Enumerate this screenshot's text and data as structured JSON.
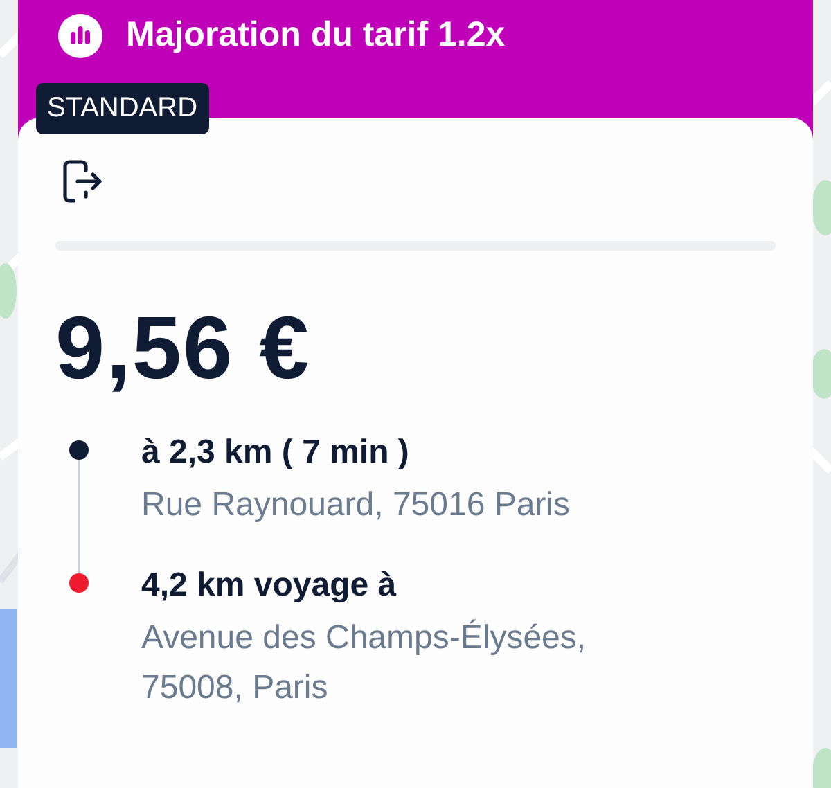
{
  "banner": {
    "title": "Majoration du tarif 1.2x"
  },
  "badge": "STANDARD",
  "price": "9,56 €",
  "stops": [
    {
      "title": "à 2,3 km ( 7 min )",
      "address": "Rue Raynouard, 75016 Paris",
      "color": "#0f1c33"
    },
    {
      "title": "4,2 km voyage à",
      "address": "Avenue des Champs-Élysées, 75008, Paris",
      "color": "#ee1c2e"
    }
  ]
}
